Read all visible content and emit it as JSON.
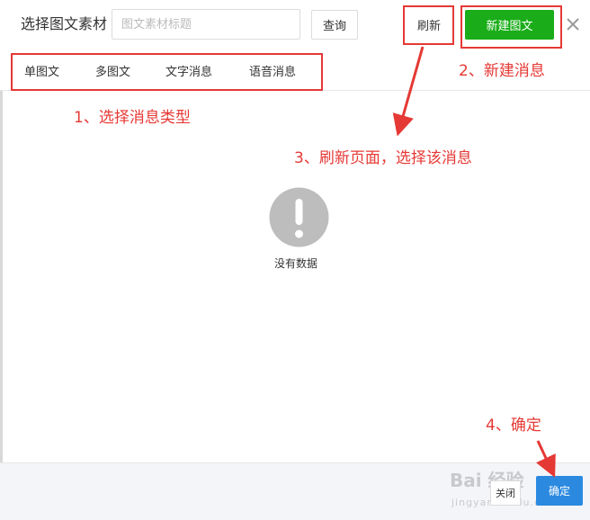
{
  "header": {
    "title": "选择图文素材",
    "search": {
      "placeholder": "图文素材标题",
      "value": ""
    },
    "query_label": "查询",
    "refresh_label": "刷新",
    "new_label": "新建图文"
  },
  "tabs": [
    {
      "label": "单图文"
    },
    {
      "label": "多图文"
    },
    {
      "label": "文字消息"
    },
    {
      "label": "语音消息"
    }
  ],
  "annotations": {
    "a1": "1、选择消息类型",
    "a2": "2、新建消息",
    "a3": "3、刷新页面，选择该消息",
    "a4": "4、确定"
  },
  "empty": {
    "text": "没有数据"
  },
  "footer": {
    "close_label": "关闭",
    "ok_label": "确定"
  },
  "watermark": {
    "main": "Bai 经验",
    "sub": "jingyan.baidu.com"
  },
  "colors": {
    "primary_green": "#1aad19",
    "primary_blue": "#2b8ae0",
    "annotation_red": "#e53935",
    "empty_icon_gray": "#bdbdbd"
  },
  "icons": {
    "close": "close-icon",
    "empty": "exclamation-circle-icon"
  }
}
